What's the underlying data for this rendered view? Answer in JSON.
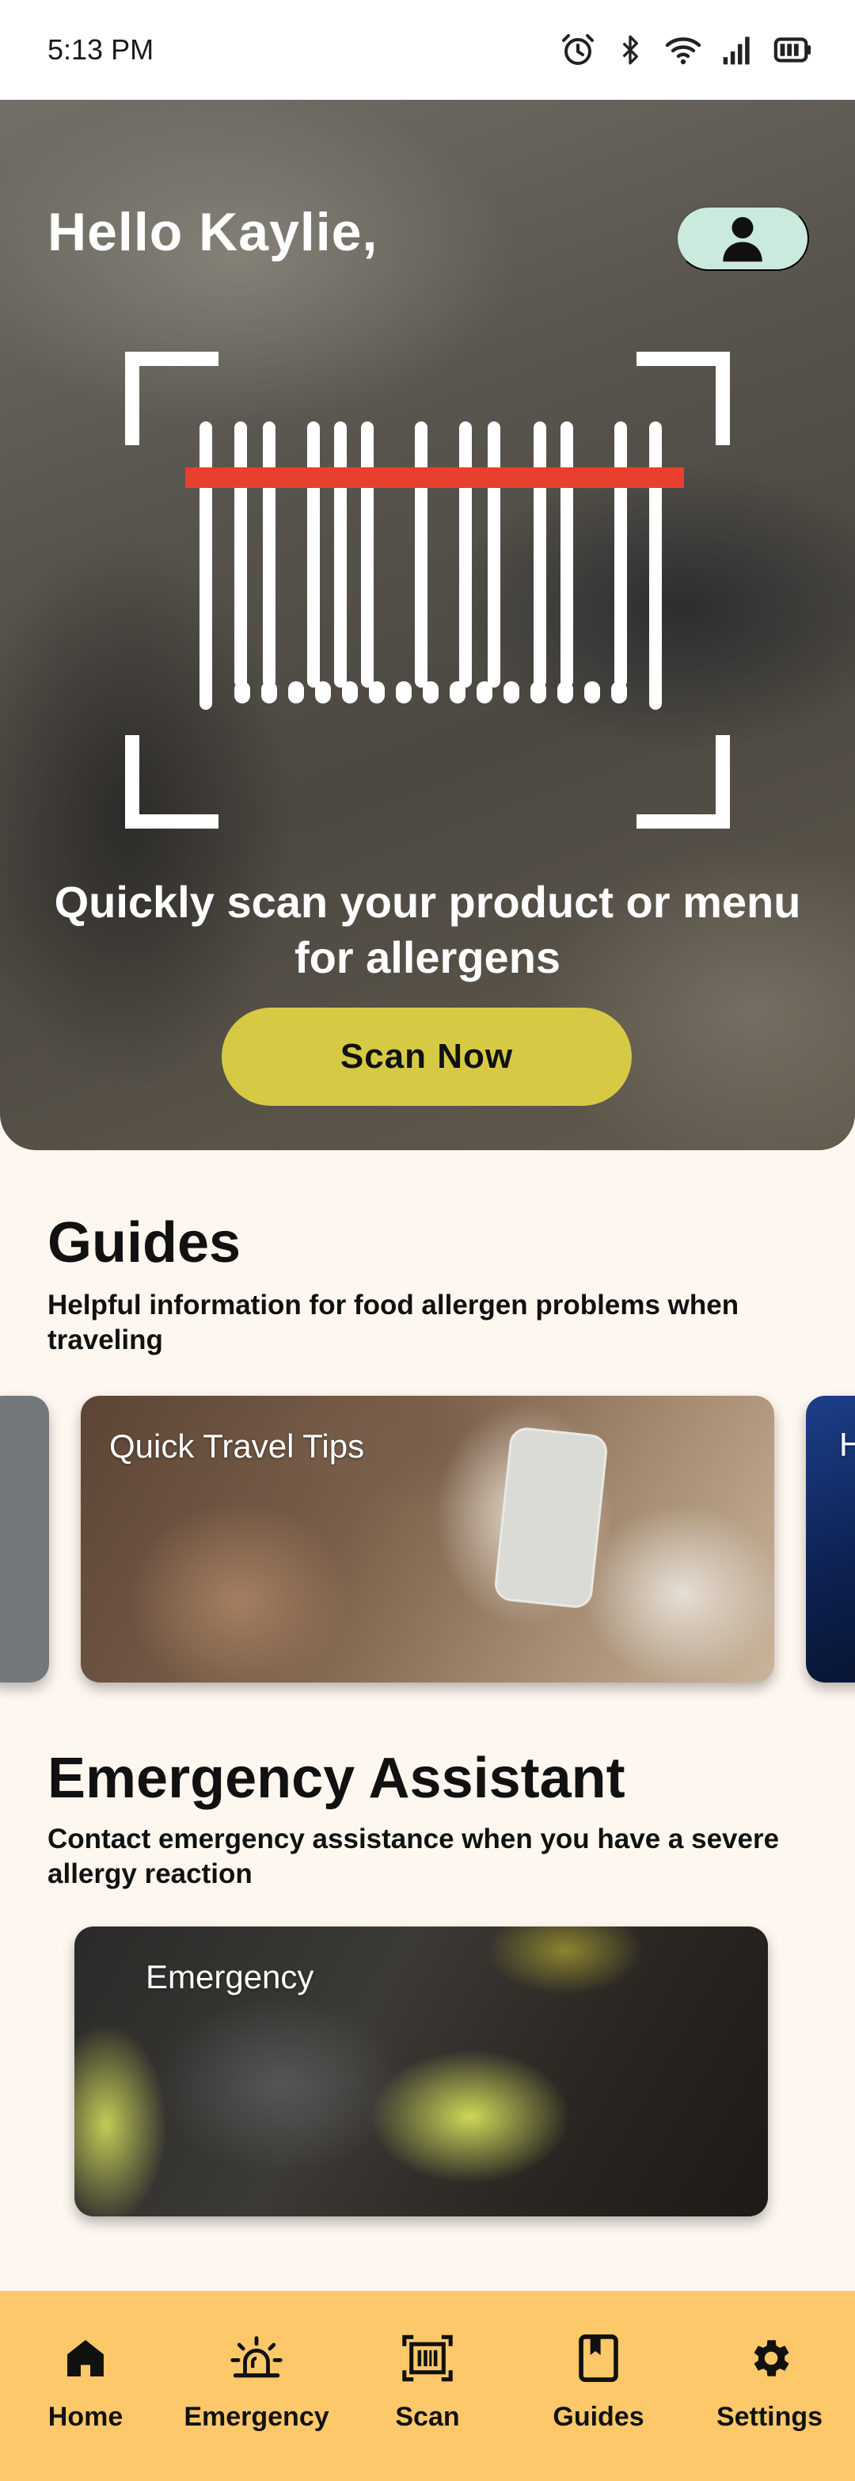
{
  "status_bar": {
    "time": "5:13 PM",
    "icons": [
      "alarm-icon",
      "bluetooth-icon",
      "wifi-icon",
      "signal-icon",
      "battery-icon"
    ]
  },
  "hero": {
    "greeting": "Hello Kaylie,",
    "profile_icon": "person-icon",
    "headline": "Quickly scan your product or menu for allergens",
    "scan_button_label": "Scan Now",
    "scan_line_color": "#e8402e",
    "button_color": "#d6ca45"
  },
  "guides": {
    "title": "Guides",
    "subtitle": "Helpful information for food allergen problems when traveling",
    "cards": [
      {
        "label": ""
      },
      {
        "label": "Quick Travel Tips"
      },
      {
        "label": "H"
      }
    ]
  },
  "emergency": {
    "title": "Emergency Assistant",
    "subtitle": "Contact emergency assistance when you have a severe allergy reaction",
    "card_label": "Emergency"
  },
  "bottom_nav": {
    "background": "#fcc86a",
    "items": [
      {
        "label": "Home",
        "icon": "home-icon"
      },
      {
        "label": "Emergency",
        "icon": "siren-icon"
      },
      {
        "label": "Scan",
        "icon": "barcode-scan-icon"
      },
      {
        "label": "Guides",
        "icon": "book-icon"
      },
      {
        "label": "Settings",
        "icon": "gear-icon"
      }
    ]
  }
}
